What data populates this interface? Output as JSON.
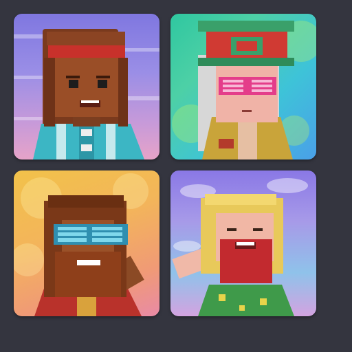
{
  "cards": [
    {
      "name": "avatar-card-1",
      "bg": "#8f86e2"
    },
    {
      "name": "avatar-card-2",
      "bg": "#3fc8b8"
    },
    {
      "name": "avatar-card-3",
      "bg": "#f2b65a"
    },
    {
      "name": "avatar-card-4",
      "bg": "#9c90e6"
    }
  ],
  "colors": {
    "page_background": "#34353f",
    "card_radius_style": "rounded"
  }
}
